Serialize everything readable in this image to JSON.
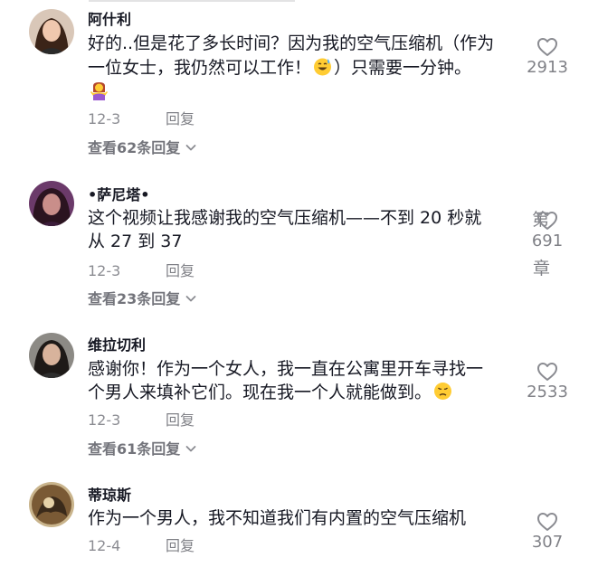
{
  "comments": [
    {
      "username": "阿什利",
      "lines": [
        "好的..但是花了多长时间？因为我的空气压缩机（作为",
        "一位女士，我仍然可以工作！",
        "）只需要一分钟。"
      ],
      "emojis": [
        "sweat-smile-emoji",
        "woman-shrugging-emoji"
      ],
      "date": "12-3",
      "reply_label": "回复",
      "view_replies": "查看62条回复",
      "likes": "2913"
    },
    {
      "username": "•萨尼塔•",
      "lines": [
        "这个视频让我感谢我的空气压缩机——不到 20 秒就",
        "从 27 到 37"
      ],
      "date": "12-3",
      "reply_label": "回复",
      "view_replies": "查看23条回复",
      "likes": "691",
      "overlay_top": "第",
      "overlay_bottom": "章"
    },
    {
      "username": "维拉切利",
      "lines": [
        "感谢你！作为一个女人，我一直在公寓里开车寻找一",
        "个男人来填补它们。现在我一个人就能做到。"
      ],
      "emojis": [
        "disappointed-face-emoji"
      ],
      "date": "12-3",
      "reply_label": "回复",
      "view_replies": "查看61条回复",
      "likes": "2533"
    },
    {
      "username": "蒂琼斯",
      "lines": [
        "作为一个男人，我不知道我们有内置的空气压缩机"
      ],
      "date": "12-4",
      "reply_label": "回复",
      "likes": "307"
    }
  ],
  "colors": {
    "text_primary": "#161823",
    "text_secondary": "#8a8b91",
    "heart_outline": "#8a8b91",
    "divider": "#e3e3e4"
  },
  "icons": {
    "like": "heart-outline-icon",
    "expand": "chevron-down-icon"
  }
}
